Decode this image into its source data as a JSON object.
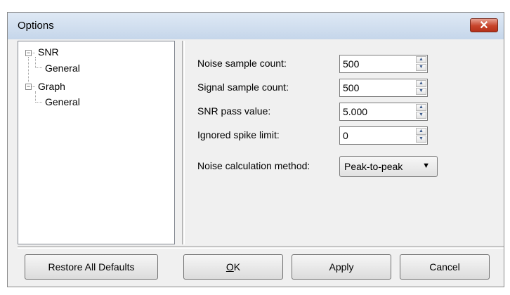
{
  "window": {
    "title": "Options",
    "close_symbol": "✕"
  },
  "tree": {
    "nodes": [
      {
        "label": "SNR",
        "expanded": true,
        "children": [
          {
            "label": "General"
          }
        ]
      },
      {
        "label": "Graph",
        "expanded": true,
        "children": [
          {
            "label": "General"
          }
        ]
      }
    ],
    "collapse_symbol": "−"
  },
  "settings": {
    "noise_sample_count": {
      "label": "Noise sample count:",
      "value": "500"
    },
    "signal_sample_count": {
      "label": "Signal sample count:",
      "value": "500"
    },
    "snr_pass_value": {
      "label": "SNR pass value:",
      "value": "5.000"
    },
    "ignored_spike_limit": {
      "label": "Ignored spike limit:",
      "value": "0"
    },
    "noise_calculation_method": {
      "label": "Noise calculation method:",
      "value": "Peak-to-peak"
    }
  },
  "buttons": {
    "restore_defaults": "Restore All Defaults",
    "ok_mnemonic": "O",
    "ok_rest": "K",
    "apply": "Apply",
    "cancel": "Cancel"
  },
  "icons": {
    "spin_up": "▲",
    "spin_down": "▼",
    "dropdown": "▼"
  }
}
